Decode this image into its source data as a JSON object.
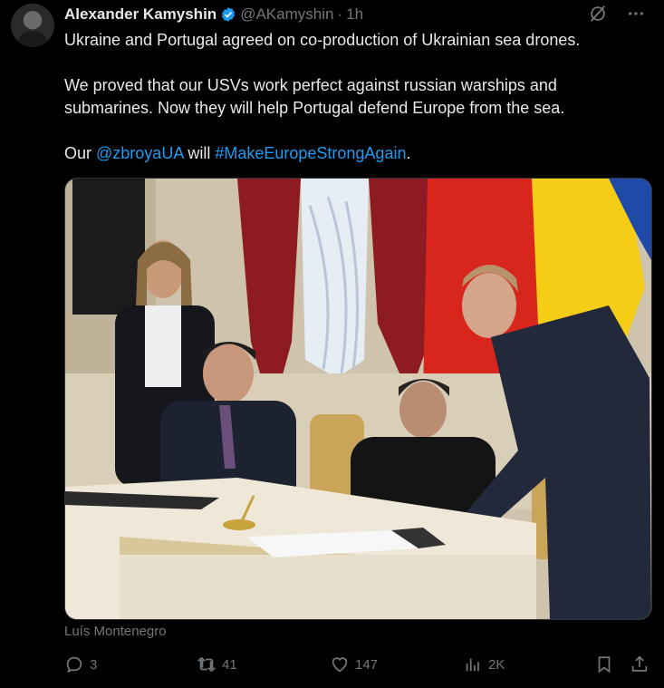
{
  "tweet": {
    "author_name": "Alexander Kamyshin",
    "handle": "@AKamyshin",
    "separator": "·",
    "time": "1h",
    "line1": "Ukraine and Portugal agreed on co-production of Ukrainian sea drones.",
    "line2": "We proved that our USVs work perfect against russian warships and submarines. Now they will help Portugal defend Europe from the sea.",
    "line3_prefix": "Our ",
    "mention": "@zbroyaUA",
    "line3_mid": " will ",
    "hashtag": "#MakeEuropeStrongAgain",
    "line3_suffix": ".",
    "media_caption": "Luís Montenegro"
  },
  "actions": {
    "replies": "3",
    "reposts": "41",
    "likes": "147",
    "views": "2K"
  },
  "icons": {
    "verified": "verified-badge-icon",
    "grok": "grok-icon",
    "more": "more-icon",
    "reply": "reply-icon",
    "repost": "repost-icon",
    "like": "heart-icon",
    "views": "views-icon",
    "bookmark": "bookmark-icon",
    "share": "share-icon"
  },
  "colors": {
    "background": "#000000",
    "text": "#e7e9ea",
    "secondary": "#71767b",
    "accent": "#1d9bf0"
  }
}
